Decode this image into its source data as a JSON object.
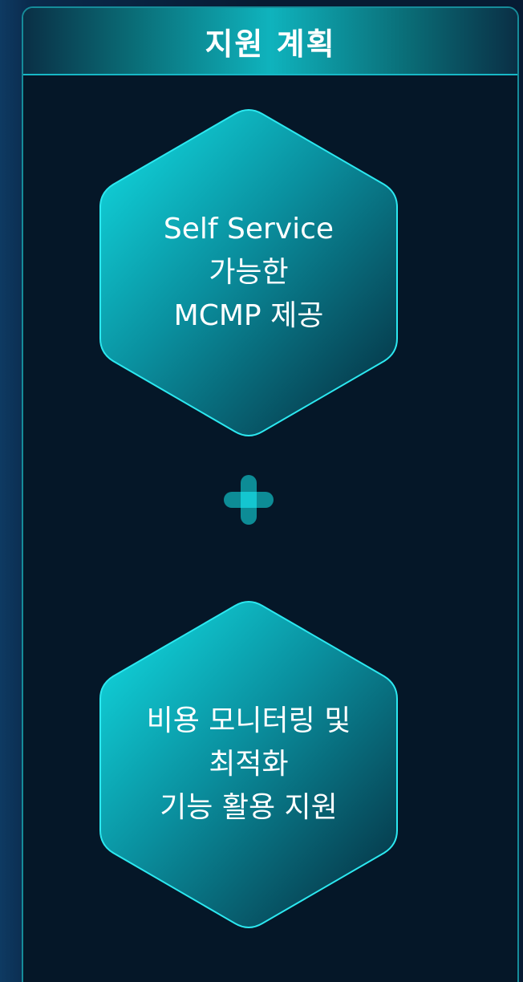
{
  "panel": {
    "title": "지원 계획"
  },
  "cards": [
    {
      "lines": [
        "Self Service",
        "가능한",
        "MCMP 제공"
      ]
    },
    {
      "lines": [
        "비용 모니터링 및",
        "최적화",
        "기능 활용 지원"
      ]
    }
  ],
  "separator_icon": "plus-icon",
  "colors": {
    "accent": "#00d4e0",
    "panel_border": "#168c9a",
    "panel_bg": "#051728",
    "hex_gradient_start": "#10d8df",
    "hex_gradient_end": "#062b3d"
  }
}
